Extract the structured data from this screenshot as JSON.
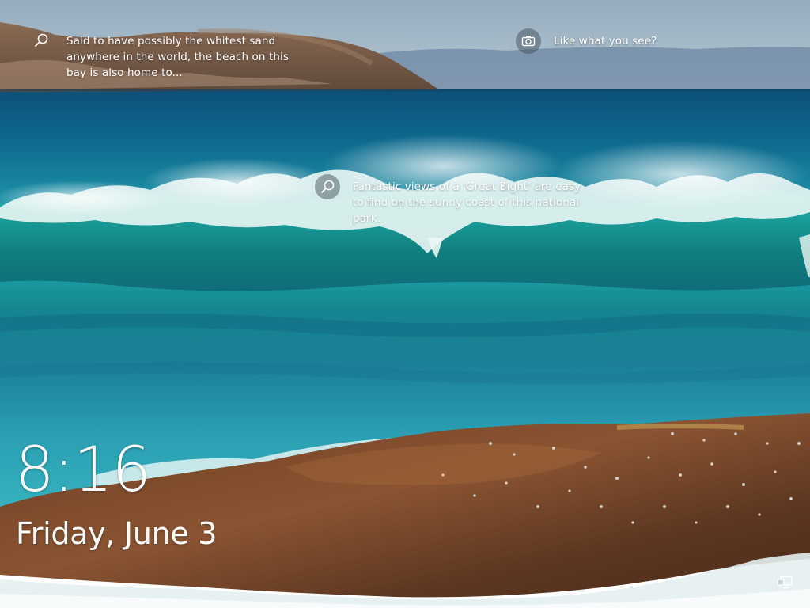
{
  "spotlight": {
    "hotspot_island": {
      "icon": "search-icon",
      "text": "Said to have possibly the whitest sand anywhere in the world, the beach on this bay is also home to..."
    },
    "like_prompt": {
      "icon": "camera-icon",
      "text": "Like what you see?"
    },
    "hotspot_wave": {
      "icon": "search-icon",
      "text": "Fantastic views of a 'Great Bight' are easy to find on the sunny coast of this national park."
    }
  },
  "clock": {
    "time": "8:16",
    "date": "Friday, June 3"
  },
  "status": {
    "network_icon": "network-icon"
  },
  "colors": {
    "sky": "#9fb4c4",
    "deep_sea": "#0e5a7e",
    "turquoise": "#1aa7a6",
    "foam": "#e8f3f2",
    "rock": "#7a4a2e"
  }
}
